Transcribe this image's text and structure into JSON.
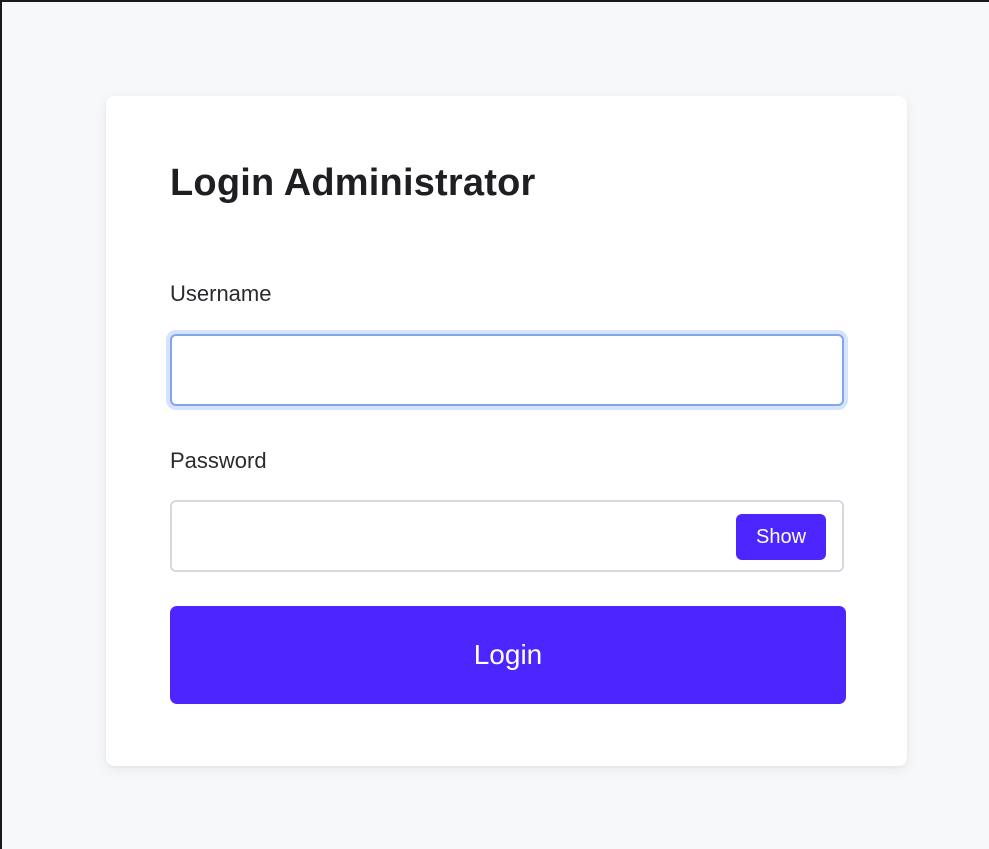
{
  "login": {
    "title": "Login Administrator",
    "username_label": "Username",
    "username_value": "",
    "username_placeholder": "",
    "password_label": "Password",
    "password_value": "",
    "password_placeholder": "",
    "show_label": "Show",
    "login_label": "Login"
  },
  "colors": {
    "page_background": "#f7f8fa",
    "card_background": "#ffffff",
    "accent": "#4c25ff",
    "focus_ring": "#7fa6ef",
    "input_border": "#d5d9e0"
  }
}
